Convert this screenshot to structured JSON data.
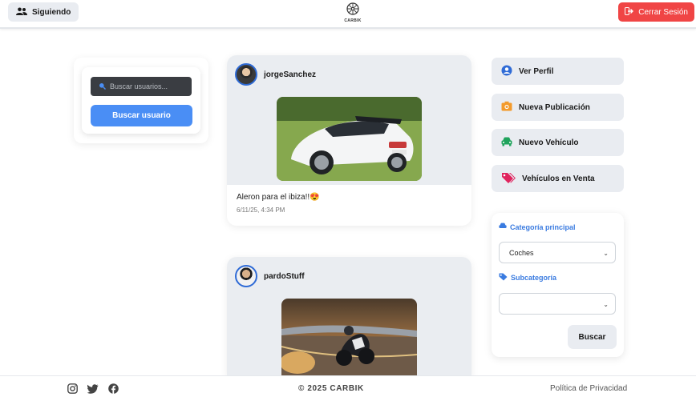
{
  "header": {
    "following_label": "Siguiendo",
    "logo_text": "CARBIK",
    "logout_label": "Cerrar Sesión",
    "logout_color": "#f04545"
  },
  "search": {
    "placeholder": "Buscar usuarios...",
    "button_label": "Buscar usuario",
    "accent": "#4a8ef5"
  },
  "posts": [
    {
      "username": "jorgeSanchez",
      "caption": "Aleron para el ibiza!!😍",
      "time": "6/11/25, 4:34 PM",
      "image": "white-seat-ibiza-car"
    },
    {
      "username": "pardoStuff",
      "image": "motorcycle-racing"
    }
  ],
  "menu": [
    {
      "label": "Ver Perfil",
      "icon": "user-circle-icon",
      "color": "#2f6bd6"
    },
    {
      "label": "Nueva Publicación",
      "icon": "camera-icon",
      "color": "#f39a2b"
    },
    {
      "label": "Nuevo Vehículo",
      "icon": "car-icon",
      "color": "#1fa35c"
    },
    {
      "label": "Vehículos en Venta",
      "icon": "tags-icon",
      "color": "#e0245e"
    }
  ],
  "filter": {
    "category_label": "Categoría principal",
    "category_value": "Coches",
    "subcategory_label": "Subcategoría",
    "subcategory_value": "",
    "button_label": "Buscar"
  },
  "footer": {
    "copyright": "© 2025 CARBIK",
    "privacy": "Política de Privacidad",
    "social_icons": [
      "instagram-icon",
      "twitter-icon",
      "facebook-icon"
    ]
  }
}
